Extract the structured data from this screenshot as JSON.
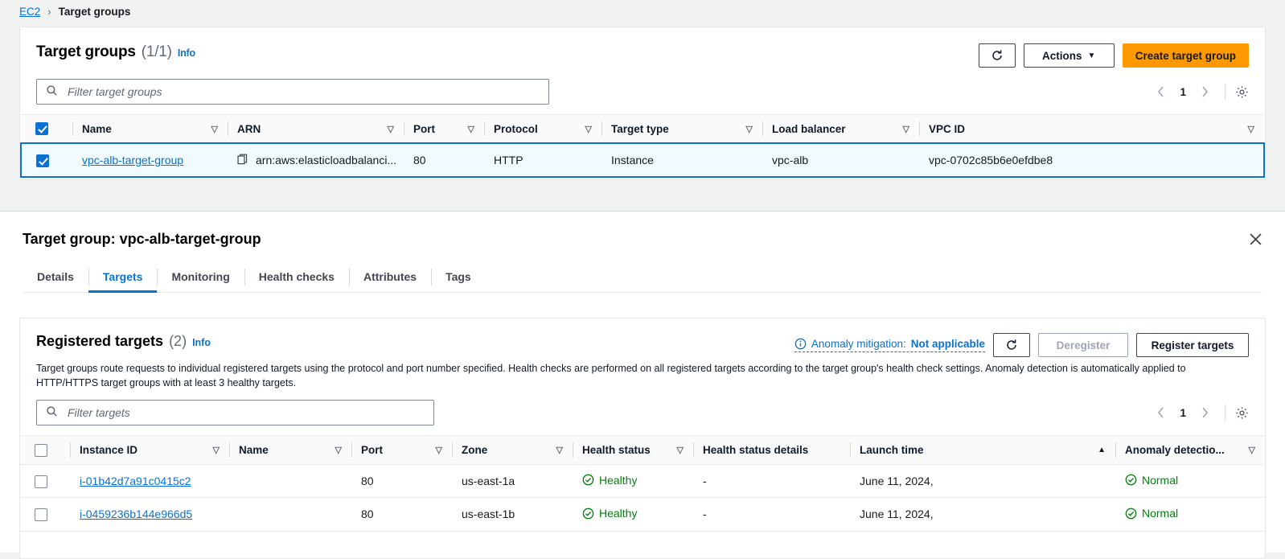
{
  "breadcrumb": {
    "root": "EC2",
    "separator": "›",
    "current": "Target groups"
  },
  "target_groups_panel": {
    "title": "Target groups",
    "count": "(1/1)",
    "info_label": "Info",
    "refresh_icon": "refresh-icon",
    "actions_label": "Actions",
    "create_label": "Create target group",
    "search_placeholder": "Filter target groups",
    "page_number": "1",
    "columns": [
      "Name",
      "ARN",
      "Port",
      "Protocol",
      "Target type",
      "Load balancer",
      "VPC ID"
    ],
    "rows": [
      {
        "selected": true,
        "name": "vpc-alb-target-group",
        "arn": "arn:aws:elasticloadbalanci...",
        "port": "80",
        "protocol": "HTTP",
        "target_type": "Instance",
        "load_balancer": "vpc-alb",
        "vpc_id": "vpc-0702c85b6e0efdbe8"
      }
    ]
  },
  "detail": {
    "title": "Target group: vpc-alb-target-group",
    "close_icon": "close-icon",
    "tabs": [
      {
        "label": "Details",
        "active": false
      },
      {
        "label": "Targets",
        "active": true
      },
      {
        "label": "Monitoring",
        "active": false
      },
      {
        "label": "Health checks",
        "active": false
      },
      {
        "label": "Attributes",
        "active": false
      },
      {
        "label": "Tags",
        "active": false
      }
    ]
  },
  "registered_targets": {
    "title": "Registered targets",
    "count": "(2)",
    "info_label": "Info",
    "description": "Target groups route requests to individual registered targets using the protocol and port number specified. Health checks are performed on all registered targets according to the target group's health check settings. Anomaly detection is automatically applied to HTTP/HTTPS target groups with at least 3 healthy targets.",
    "anomaly_label": "Anomaly mitigation:",
    "anomaly_value": "Not applicable",
    "refresh_icon": "refresh-icon",
    "deregister_label": "Deregister",
    "register_label": "Register targets",
    "search_placeholder": "Filter targets",
    "page_number": "1",
    "columns": [
      {
        "label": "Instance ID",
        "sortable": true,
        "sorted": false
      },
      {
        "label": "Name",
        "sortable": true,
        "sorted": false
      },
      {
        "label": "Port",
        "sortable": true,
        "sorted": false
      },
      {
        "label": "Zone",
        "sortable": true,
        "sorted": false
      },
      {
        "label": "Health status",
        "sortable": true,
        "sorted": false
      },
      {
        "label": "Health status details",
        "sortable": false,
        "sorted": false
      },
      {
        "label": "Launch time",
        "sortable": true,
        "sorted": true
      },
      {
        "label": "Anomaly detectio...",
        "sortable": true,
        "sorted": false
      }
    ],
    "rows": [
      {
        "instance_id": "i-01b42d7a91c0415c2",
        "name": "",
        "port": "80",
        "zone": "us-east-1a",
        "health_status": "Healthy",
        "health_status_details": "-",
        "launch_time": "June 11, 2024,",
        "anomaly_detection": "Normal"
      },
      {
        "instance_id": "i-0459236b144e966d5",
        "name": "",
        "port": "80",
        "zone": "us-east-1b",
        "health_status": "Healthy",
        "health_status_details": "-",
        "launch_time": "June 11, 2024,",
        "anomaly_detection": "Normal"
      }
    ]
  },
  "colors": {
    "accent_blue": "#0972d3",
    "primary_orange": "#ff9900",
    "status_green": "#037f0c",
    "selected_row": "#f1faff"
  }
}
